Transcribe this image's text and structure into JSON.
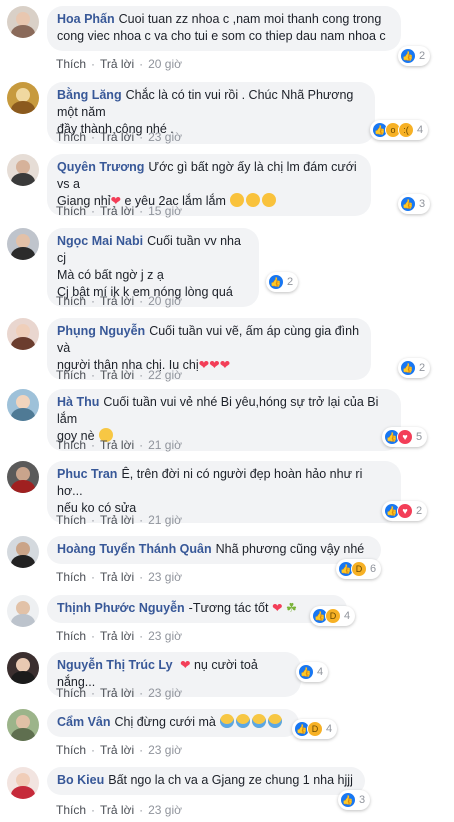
{
  "action_labels": {
    "like": "Thích",
    "reply": "Trả lời",
    "separator": "·"
  },
  "comments": [
    {
      "author": "Hoa Phấn",
      "lines": [
        "Cuoi tuan zz nhoa c ,nam moi thanh cong trong",
        "cong viec nhoa c va cho tui e som co thiep dau nam nhoa c"
      ],
      "time": "20 giờ",
      "reactions": [
        "like"
      ],
      "count": "2"
    },
    {
      "author": "Bằng Lăng",
      "lines": [
        "Chắc là có tin vui rồi . Chúc Nhã Phương một năm",
        "đầy thành công nhé ."
      ],
      "time": "23 giờ",
      "reactions": [
        "like",
        "wow",
        "sad"
      ],
      "count": "4"
    },
    {
      "author": "Quyên Trương",
      "lines": [
        "Ước gì bất ngờ ấy là chị lm đám cưới vs a",
        "Giang nhỉ",
        " e yêu 2ac lắm lắm"
      ],
      "time": "15 giờ",
      "reactions": [
        "like"
      ],
      "count": "3"
    },
    {
      "author": "Ngọc Mai Nabi",
      "lines": [
        "Cuối tuần vv nha cj",
        "Mà có bất ngờ j z ạ",
        "Cj bật mí ik k em nóng lòng quá"
      ],
      "time": "20 giờ",
      "reactions": [
        "like"
      ],
      "count": "2"
    },
    {
      "author": "Phụng Nguyễn",
      "lines": [
        "Cuối tuần vui vẽ, ấm áp cùng gia đình và",
        "người thân nha chị. Iu chị"
      ],
      "time": "22 giờ",
      "reactions": [
        "like"
      ],
      "count": "2"
    },
    {
      "author": "Hà Thu",
      "lines": [
        "Cuối tuần vui vẻ nhé Bi yêu,hóng sự trở lại của Bi lắm",
        "goy nè"
      ],
      "time": "21 giờ",
      "reactions": [
        "like",
        "love"
      ],
      "count": "5"
    },
    {
      "author": "Phuc Tran",
      "lines": [
        "Ê, trên đời ni có người đẹp hoàn hảo như ri hơ...",
        "nếu ko có sửa"
      ],
      "time": "21 giờ",
      "reactions": [
        "like",
        "love"
      ],
      "count": "2"
    },
    {
      "author": "Hoàng Tuyển Thánh Quân",
      "lines": [
        "Nhã phương cũng vậy nhé"
      ],
      "time": "23 giờ",
      "reactions": [
        "like",
        "haha"
      ],
      "count": "6"
    },
    {
      "author": "Thịnh Phước Nguyễn",
      "lines": [
        "-Tương tác tốt"
      ],
      "time": "23 giờ",
      "reactions": [
        "like",
        "haha"
      ],
      "count": "4"
    },
    {
      "author": "Nguyễn Thị Trúc Ly",
      "lines": [
        "nụ cười toả nắng..."
      ],
      "time": "23 giờ",
      "reactions": [
        "like"
      ],
      "count": "4"
    },
    {
      "author": "Cẩm Vân",
      "lines": [
        "Chị đừng cưới mà"
      ],
      "time": "23 giờ",
      "reactions": [
        "like",
        "haha"
      ],
      "count": "4"
    },
    {
      "author": "Bo Kieu",
      "lines": [
        "Bất ngo la ch va a Gjang ze chung 1 nha hjjj"
      ],
      "time": "23 giờ",
      "reactions": [
        "like"
      ],
      "count": "3"
    }
  ],
  "colors": {
    "author": "#385898",
    "bubble": "#f2f3f5",
    "like": "#1877f2",
    "love": "#f33e58",
    "haha": "#f7b125"
  }
}
